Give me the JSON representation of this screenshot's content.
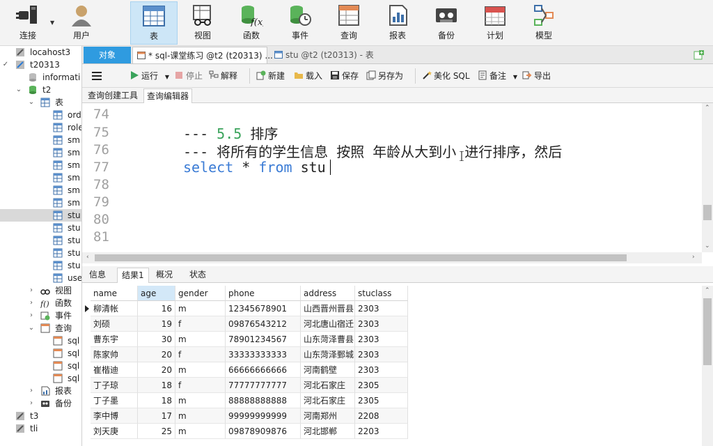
{
  "toolbar": {
    "connect": "连接",
    "user": "用户",
    "table": "表",
    "view": "视图",
    "function": "函数",
    "event": "事件",
    "query": "查询",
    "report": "报表",
    "backup": "备份",
    "schedule": "计划",
    "model": "模型"
  },
  "nav": {
    "items": [
      {
        "text": "locahost3"
      },
      {
        "text": "t20313"
      },
      {
        "text": "informati"
      },
      {
        "text": "t2"
      },
      {
        "text": "表"
      },
      {
        "text": "ord"
      },
      {
        "text": "role"
      },
      {
        "text": "sm"
      },
      {
        "text": "sm"
      },
      {
        "text": "sm"
      },
      {
        "text": "sm"
      },
      {
        "text": "sm"
      },
      {
        "text": "sm"
      },
      {
        "text": "stu"
      },
      {
        "text": "stu"
      },
      {
        "text": "stu"
      },
      {
        "text": "stu"
      },
      {
        "text": "stu"
      },
      {
        "text": "use"
      },
      {
        "text": "视图"
      },
      {
        "text": "函数"
      },
      {
        "text": "事件"
      },
      {
        "text": "查询"
      },
      {
        "text": "sql"
      },
      {
        "text": "sql"
      },
      {
        "text": "sql"
      },
      {
        "text": "sql"
      },
      {
        "text": "报表"
      },
      {
        "text": "备份"
      },
      {
        "text": "t3"
      },
      {
        "text": "tli"
      }
    ]
  },
  "tabs": {
    "objects": "对象",
    "query_tab": "* sql-课堂练习 @t2 (t20313) ...",
    "table_tab": "stu @t2 (t20313) - 表"
  },
  "actions": {
    "run": "运行",
    "stop": "停止",
    "explain": "解释",
    "new": "新建",
    "load": "载入",
    "save": "保存",
    "save_as": "另存为",
    "beautify": "美化 SQL",
    "notes": "备注",
    "export": "导出"
  },
  "subtabs": {
    "builder": "查询创建工具",
    "editor": "查询编辑器"
  },
  "editor": {
    "line_numbers": [
      "74",
      "75",
      "76",
      "77",
      "78",
      "79",
      "80",
      "81"
    ],
    "l75_prefix": "--- ",
    "l75_num": "5.5",
    "l75_text": "  排序",
    "l76_text": "--- 将所有的学生信息 按照 年龄从大到小 进行排序，然后",
    "l77_kw1": "select",
    "l77_star": " * ",
    "l77_kw2": "from",
    "l77_tbl": " stu"
  },
  "result_tabs": {
    "info": "信息",
    "result1": "结果1",
    "profile": "概况",
    "status": "状态"
  },
  "grid": {
    "columns": [
      "name",
      "age",
      "gender",
      "phone",
      "address",
      "stuclass"
    ],
    "rows": [
      [
        "柳清帐",
        "16",
        "m",
        "12345678901",
        "山西晋州晋县",
        "2303"
      ],
      [
        "刘硕",
        "19",
        "f",
        "09876543212",
        "河北唐山宿迁",
        "2303"
      ],
      [
        "曹东宇",
        "30",
        "m",
        "78901234567",
        "山东菏泽曹县",
        "2303"
      ],
      [
        "陈家帅",
        "20",
        "f",
        "33333333333",
        "山东菏泽鄄城",
        "2303"
      ],
      [
        "崔楷迪",
        "20",
        "m",
        "66666666666",
        "河南鹤壁",
        "2303"
      ],
      [
        "丁子琼",
        "18",
        "f",
        "77777777777",
        "河北石家庄",
        "2305"
      ],
      [
        "丁子墨",
        "18",
        "m",
        "88888888888",
        "河北石家庄",
        "2305"
      ],
      [
        "李中博",
        "17",
        "m",
        "99999999999",
        "河南郑州",
        "2208"
      ],
      [
        "刘天庚",
        "25",
        "m",
        "09878909876",
        "河北邯郸",
        "2203"
      ]
    ]
  },
  "colors": {
    "accent": "#2f9be0",
    "keyword": "#3a7bd5",
    "number": "#3aa35b",
    "line_number": "#a0a0a0"
  }
}
